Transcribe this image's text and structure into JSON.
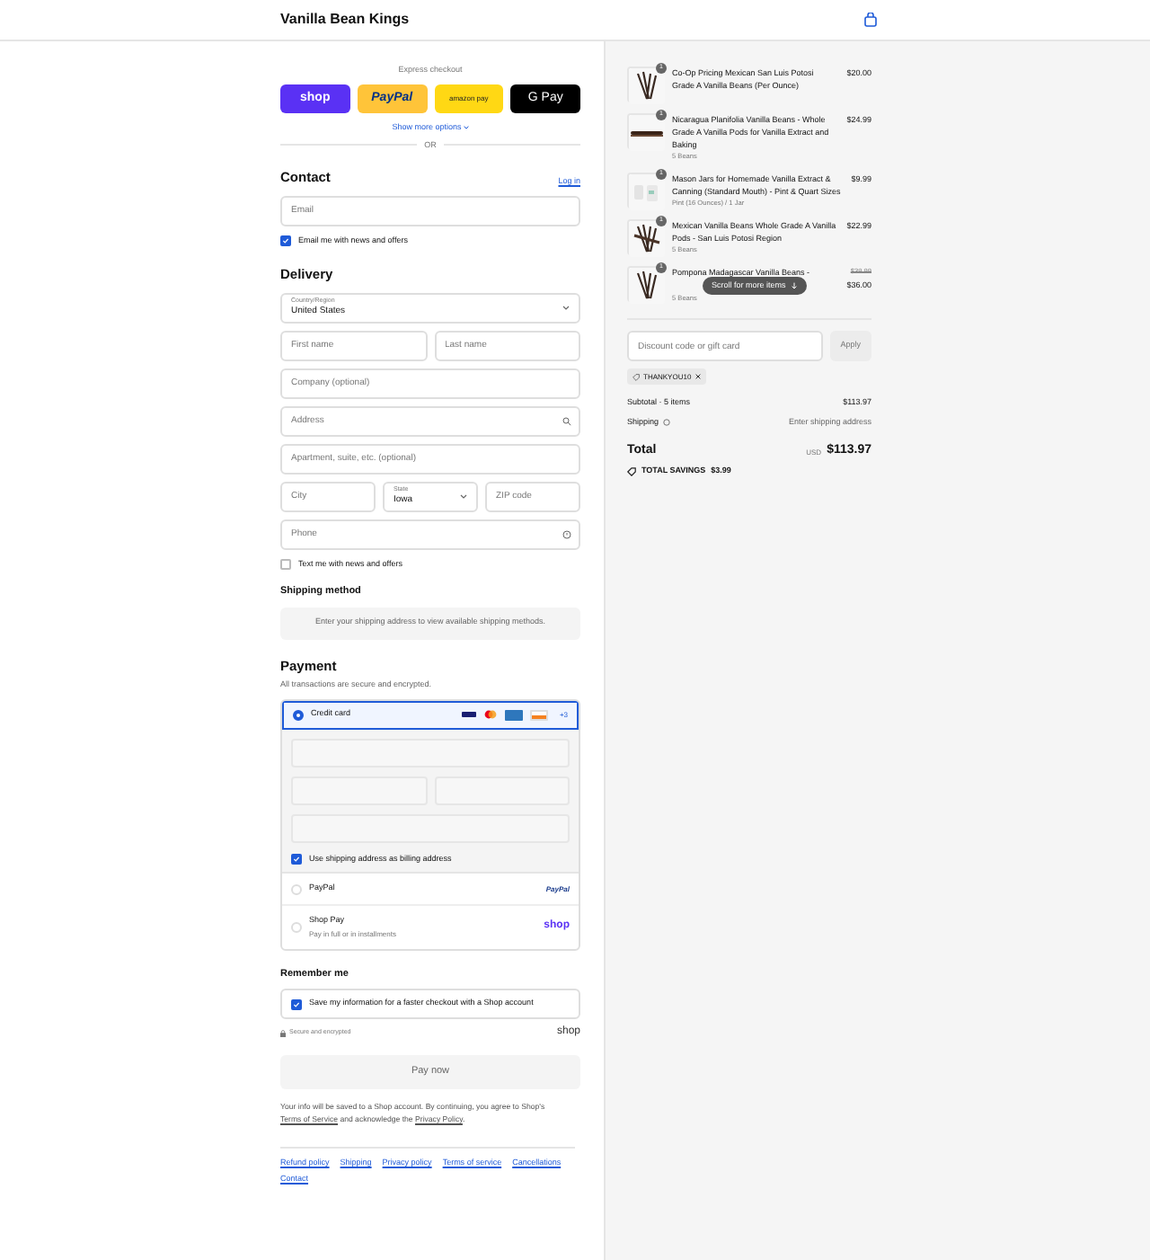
{
  "store": {
    "name": "Vanilla Bean Kings"
  },
  "express": {
    "label": "Express checkout",
    "buttons": [
      {
        "kind": "shop",
        "label": "shop"
      },
      {
        "kind": "paypal",
        "label": "PayPal"
      },
      {
        "kind": "amazon",
        "label": "amazon pay"
      },
      {
        "kind": "gpay",
        "label": "G Pay"
      }
    ],
    "more": "Show more options",
    "or": "OR"
  },
  "contact": {
    "title": "Contact",
    "login": "Log in",
    "email": {
      "placeholder": "Email"
    },
    "newsletter": {
      "label": "Email me with news and offers",
      "checked": true
    }
  },
  "delivery": {
    "title": "Delivery",
    "country": {
      "label": "Country/Region",
      "value": "United States"
    },
    "first_name": {
      "placeholder": "First name"
    },
    "last_name": {
      "placeholder": "Last name"
    },
    "company": {
      "placeholder": "Company (optional)"
    },
    "address": {
      "placeholder": "Address"
    },
    "apartment": {
      "placeholder": "Apartment, suite, etc. (optional)"
    },
    "city": {
      "placeholder": "City"
    },
    "state": {
      "label": "State",
      "value": "Iowa"
    },
    "zip": {
      "placeholder": "ZIP code"
    },
    "phone": {
      "placeholder": "Phone"
    },
    "sms": {
      "label": "Text me with news and offers",
      "checked": false
    }
  },
  "shipping_method": {
    "title": "Shipping method",
    "message": "Enter your shipping address to view available shipping methods."
  },
  "payment": {
    "title": "Payment",
    "subtitle": "All transactions are secure and encrypted.",
    "more_cards": "+3",
    "methods": [
      {
        "kind": "card",
        "label": "Credit card",
        "selected": true
      },
      {
        "kind": "paypal",
        "label": "PayPal",
        "logo": "PayPal",
        "selected": false
      },
      {
        "kind": "shoppay",
        "label": "Shop Pay",
        "sub": "Pay in full or in installments",
        "logo": "shop",
        "selected": false
      }
    ],
    "billing": {
      "label": "Use shipping address as billing address",
      "checked": true
    }
  },
  "remember": {
    "title": "Remember me",
    "save": {
      "label": "Save my information for a faster checkout with a Shop account",
      "checked": true
    },
    "secure": "Secure and encrypted",
    "logo": "shop"
  },
  "pay_button": "Pay now",
  "legal": [
    {
      "kind": "text",
      "text": "Your info will be saved to a Shop account. By continuing, you agree to Shop's "
    },
    {
      "kind": "link",
      "text": "Terms of Service"
    },
    {
      "kind": "text",
      "text": " and acknowledge the "
    },
    {
      "kind": "link",
      "text": "Privacy Policy"
    },
    {
      "kind": "text",
      "text": "."
    }
  ],
  "footer_links": [
    "Refund policy",
    "Shipping",
    "Privacy policy",
    "Terms of service",
    "Cancellations",
    "Contact"
  ],
  "cart": {
    "items": [
      {
        "quantity": "1",
        "title": "Co-Op Pricing Mexican San Luis Potosi Grade A Vanilla Beans (Per Ounce)",
        "price": "$20.00"
      },
      {
        "quantity": "1",
        "title": "Nicaragua Planifolia Vanilla Beans - Whole Grade A Vanilla Pods for Vanilla Extract and Baking",
        "variant": "5 Beans",
        "price": "$24.99"
      },
      {
        "quantity": "1",
        "title": "Mason Jars for Homemade Vanilla Extract & Canning (Standard Mouth) - Pint & Quart Sizes",
        "variant": "Pint (16 Ounces) / 1 Jar",
        "price": "$9.99"
      },
      {
        "quantity": "1",
        "title": "Mexican Vanilla Beans Whole Grade A Vanilla Pods - San Luis Potosi Region",
        "variant": "5 Beans",
        "price": "$22.99"
      },
      {
        "quantity": "1",
        "title": "Pompona Madagascar Vanilla Beans -",
        "variant": "5 Beans",
        "original_price": "$39.99",
        "price": "$36.00"
      }
    ],
    "scroll_hint": "Scroll for more items",
    "discount": {
      "placeholder": "Discount code or gift card",
      "button": "Apply",
      "code": "THANKYOU10"
    },
    "subtotal": {
      "label": "Subtotal · 5 items",
      "value": "$113.97"
    },
    "shipping": {
      "label": "Shipping",
      "value": "Enter shipping address"
    },
    "total": {
      "label": "Total",
      "currency": "USD",
      "value": "$113.97"
    },
    "savings": {
      "label": "TOTAL SAVINGS",
      "value": "$3.99"
    }
  }
}
